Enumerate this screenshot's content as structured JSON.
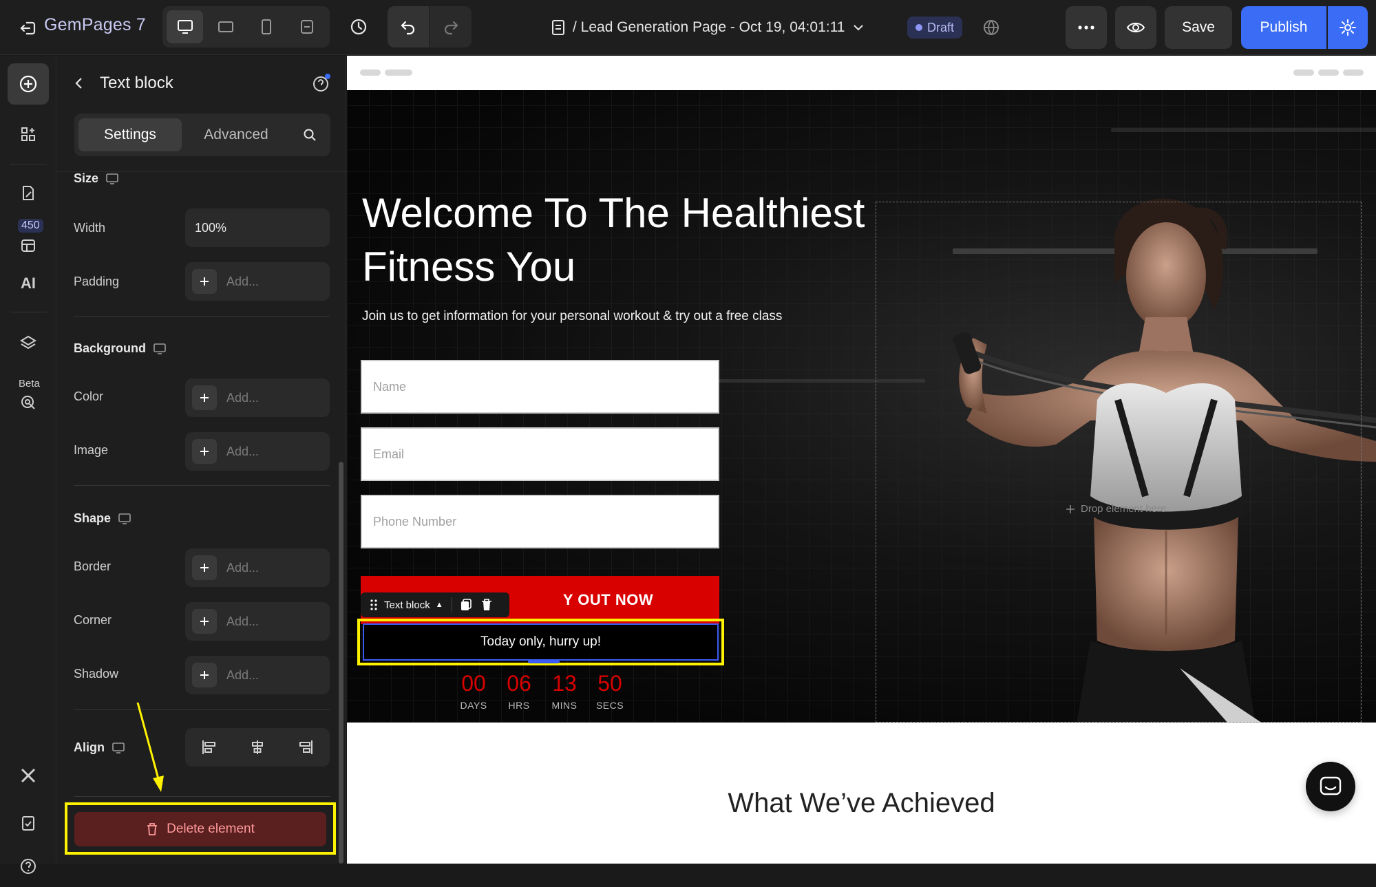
{
  "app": {
    "brand": "GemPages 7",
    "page_title": "/ Lead Generation Page - Oct 19, 04:01:11",
    "status_badge": "Draft",
    "save_label": "Save",
    "publish_label": "Publish",
    "accent_color": "#3a6cf5"
  },
  "rail": {
    "templates_count": "450",
    "ai_label": "AI",
    "beta_label": "Beta"
  },
  "panel": {
    "title": "Text block",
    "tabs": [
      "Settings",
      "Advanced"
    ],
    "sections": {
      "size": "Size",
      "background": "Background",
      "shape": "Shape",
      "align": "Align"
    },
    "rows": {
      "width_label": "Width",
      "width_value": "100%",
      "padding_label": "Padding",
      "color_label": "Color",
      "image_label": "Image",
      "border_label": "Border",
      "corner_label": "Corner",
      "shadow_label": "Shadow",
      "add_placeholder": "Add..."
    },
    "delete_label": "Delete element"
  },
  "canvas": {
    "hero_title": "Welcome To The Healthiest Fitness You",
    "hero_subtitle": "Join us to get information for your personal workout & try out a free class",
    "inputs": {
      "name_placeholder": "Name",
      "email_placeholder": "Email",
      "phone_placeholder": "Phone Number"
    },
    "cta_label": "Y OUT NOW",
    "toolbar_label": "Text block",
    "text_block": "Today only, hurry up!",
    "countdown": [
      {
        "value": "00",
        "label": "DAYS"
      },
      {
        "value": "06",
        "label": "HRS"
      },
      {
        "value": "13",
        "label": "MINS"
      },
      {
        "value": "50",
        "label": "SECS"
      }
    ],
    "drop_hint": "Drop element here",
    "section_heading": "What We’ve Achieved"
  }
}
